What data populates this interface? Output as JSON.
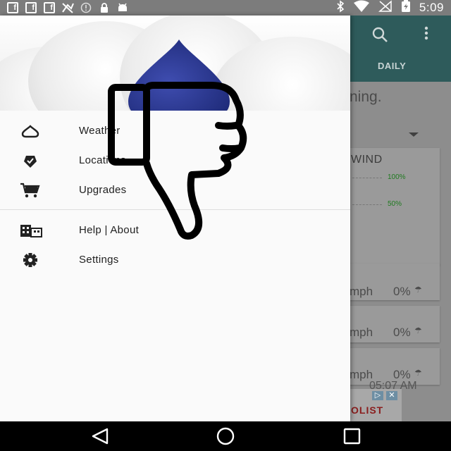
{
  "status_bar": {
    "time": "5:09",
    "left_icons": [
      "facebook-icon",
      "facebook-icon",
      "facebook-icon",
      "signal-off-icon",
      "alert-icon",
      "lock-icon",
      "android-icon"
    ],
    "right_icons": [
      "bluetooth-icon",
      "wifi-icon",
      "no-sim-icon",
      "battery-charging-icon"
    ]
  },
  "app": {
    "tab_daily": "DAILY",
    "body_text": "ning.",
    "wind_title": "WIND",
    "wind_pct_high": "100%",
    "wind_pct_mid": "50%",
    "rows": [
      {
        "wind": "mph",
        "precip": "0%"
      },
      {
        "wind": "mph",
        "precip": "0%"
      },
      {
        "wind": "mph",
        "precip": "0%"
      }
    ],
    "row_time": "05:07 AM",
    "ad_text": "OLIST"
  },
  "drawer": {
    "items": [
      {
        "label": "Weather",
        "icon": "raindrop-icon"
      },
      {
        "label": "Locations",
        "icon": "location-icon"
      },
      {
        "label": "Upgrades",
        "icon": "cart-icon"
      },
      {
        "label": "Help | About",
        "icon": "building-icon"
      },
      {
        "label": "Settings",
        "icon": "gear-icon"
      }
    ]
  },
  "nav_bar": {
    "buttons": [
      "back-icon",
      "home-icon",
      "recents-icon"
    ]
  },
  "colors": {
    "toolbar": "#2e5b5b",
    "drawer_bg": "#fafafa",
    "raindrop": "#2c3a8f",
    "status_bar": "#7c7c7c"
  }
}
